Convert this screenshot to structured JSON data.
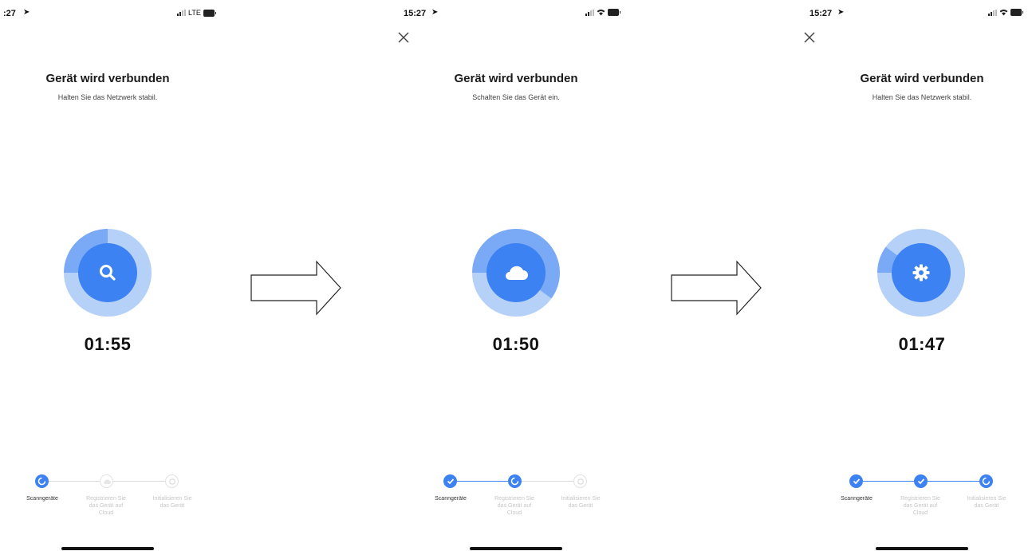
{
  "screens": [
    {
      "status_time": ":27",
      "network": "LTE",
      "battery": "",
      "title": "Gerät wird verbunden",
      "subtitle": "Halten Sie das Netzwerk stabil.",
      "icon": "search-icon",
      "progress": 0.25,
      "timer": "01:55",
      "steps": [
        {
          "label": "Scanngeräte",
          "state": "current"
        },
        {
          "label": "Registrieren Sie das Gerät auf Cloud",
          "state": "pending"
        },
        {
          "label": "Initialisieren Sie das Gerät",
          "state": "pending"
        }
      ]
    },
    {
      "status_time": "15:27",
      "network": "wifi",
      "title": "Gerät wird verbunden",
      "subtitle": "Schalten Sie das Gerät ein.",
      "icon": "cloud-icon",
      "progress": 0.6,
      "timer": "01:50",
      "steps": [
        {
          "label": "Scanngeräte",
          "state": "done"
        },
        {
          "label": "Registrieren Sie das Gerät auf Cloud",
          "state": "current"
        },
        {
          "label": "Initialisieren Sie das Gerät",
          "state": "pending"
        }
      ]
    },
    {
      "status_time": "15:27",
      "network": "wifi",
      "title": "Gerät wird verbunden",
      "subtitle": "Halten Sie das Netzwerk stabil.",
      "icon": "gear-icon",
      "progress": 0.1,
      "timer": "01:47",
      "steps": [
        {
          "label": "Scanngeräte",
          "state": "done"
        },
        {
          "label": "Registrieren Sie das Gerät auf Cloud",
          "state": "done"
        },
        {
          "label": "Initialisieren Sie das Gerät",
          "state": "current"
        }
      ]
    }
  ],
  "colors": {
    "accent": "#3d82f2",
    "ring_track": "#b6d1f8",
    "ring_fill": "#7aa9f5",
    "inactive": "#c6c6c6"
  }
}
